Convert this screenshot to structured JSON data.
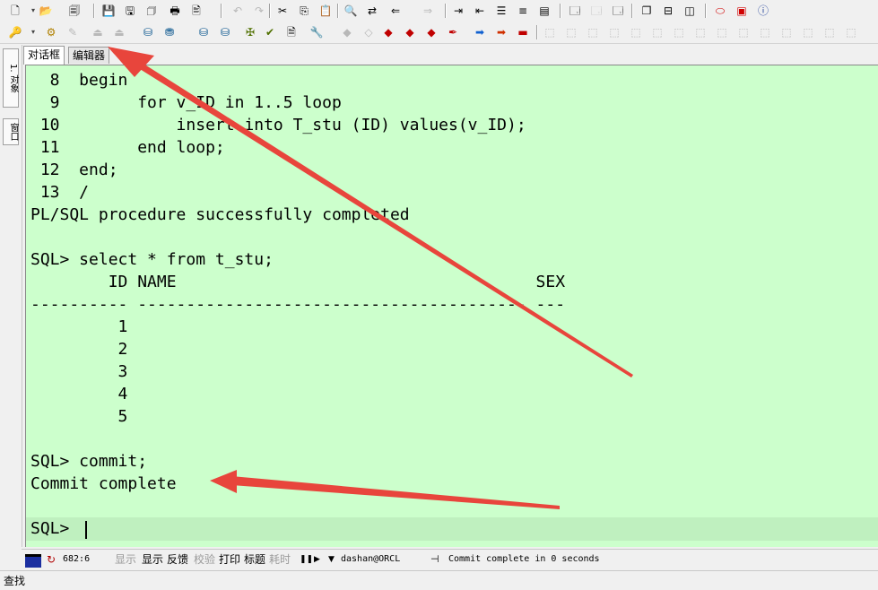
{
  "toolbar_row1": {
    "icons": [
      "new-icon",
      "open-icon",
      "print-setup-icon",
      "save-icon",
      "save-as-icon",
      "save-all-icon",
      "print-icon",
      "print-preview-icon",
      "undo-icon",
      "redo-icon",
      "cut-icon",
      "copy-icon",
      "paste-icon",
      "find-icon",
      "replace-icon",
      "import-icon",
      "export-icon",
      "indent-icon",
      "outdent-icon",
      "comment-icon",
      "uncomment-icon",
      "bookmark-icon",
      "window-icon",
      "window2-icon",
      "window3-icon",
      "cascade-icon",
      "tile-icon",
      "columns-icon",
      "oracle-icon",
      "pdf-icon",
      "info-icon"
    ]
  },
  "toolbar_row2": {
    "icons": [
      "key-icon",
      "gear-icon",
      "pin-icon",
      "run-icon",
      "run2-icon",
      "db-icon",
      "psql-icon",
      "db-run-icon",
      "db-stop-icon",
      "tools-icon",
      "form-icon",
      "doc-icon",
      "wrench-icon",
      "eraser-icon",
      "clear-icon",
      "red-box-icon",
      "multi-icon",
      "brush-icon",
      "brush2-icon",
      "right-arrow-blue-icon",
      "right-arrow-red-icon",
      "stop-icon",
      "nav-icon"
    ]
  },
  "left_tabs": {
    "objects": "1. 对象",
    "window": "窗口"
  },
  "tabs": [
    {
      "label": "对话框",
      "active": true
    },
    {
      "label": "编辑器",
      "active": false
    }
  ],
  "terminal": {
    "lines": [
      "  8  begin",
      "  9        for v_ID in 1..5 loop",
      " 10            insert into T_stu (ID) values(v_ID);",
      " 11        end loop;",
      " 12  end;",
      " 13  /",
      "PL/SQL procedure successfully completed",
      "",
      "SQL> select * from t_stu;",
      "        ID NAME                                     SEX",
      "---------- ---------------------------------------- ---",
      "         1",
      "         2",
      "         3",
      "         4",
      "         5",
      "",
      "SQL> commit;",
      "Commit complete",
      "",
      "SQL> "
    ],
    "background": "#ccffcc"
  },
  "statusbar": {
    "position": "682:6",
    "show_dim": "显示",
    "show": "显示",
    "feedback": "反馈",
    "verify": "校验",
    "print": "打印",
    "title": "标题",
    "timing": "耗时",
    "connection": "dashan@ORCL",
    "message": "Commit complete in 0 seconds"
  },
  "findbar": {
    "label": "查找"
  },
  "colors": {
    "arrow": "#e8453c",
    "terminal_bg": "#ccffcc"
  }
}
